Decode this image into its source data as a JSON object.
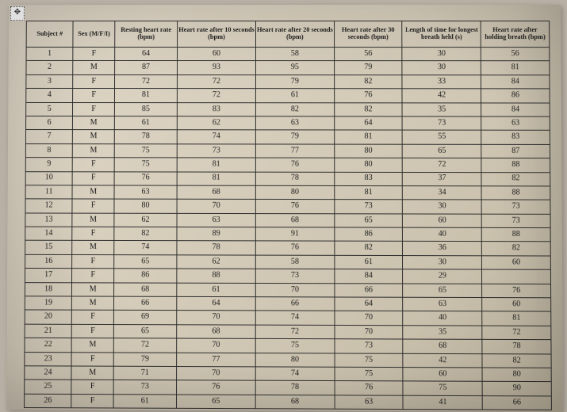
{
  "move_handle_glyph": "✥",
  "columns": [
    "Subject #",
    "Sex (M/F/I)",
    "Resting heart rate (bpm)",
    "Heart rate after 10 seconds (bpm)",
    "Heart rate after 20 seconds (bpm)",
    "Heart rate after 30 seconds (bpm)",
    "Length of time for longest breath held (s)",
    "Heart rate after holding breath (bpm)"
  ],
  "rows": [
    {
      "subject": "1",
      "sex": "F",
      "rest": "64",
      "hr10": "60",
      "hr20": "58",
      "hr30": "56",
      "time": "30",
      "hold": "56"
    },
    {
      "subject": "2",
      "sex": "M",
      "rest": "87",
      "hr10": "93",
      "hr20": "95",
      "hr30": "79",
      "time": "30",
      "hold": "81"
    },
    {
      "subject": "3",
      "sex": "F",
      "rest": "72",
      "hr10": "72",
      "hr20": "79",
      "hr30": "82",
      "time": "33",
      "hold": "84"
    },
    {
      "subject": "4",
      "sex": "F",
      "rest": "81",
      "hr10": "72",
      "hr20": "61",
      "hr30": "76",
      "time": "42",
      "hold": "86"
    },
    {
      "subject": "5",
      "sex": "F",
      "rest": "85",
      "hr10": "83",
      "hr20": "82",
      "hr30": "82",
      "time": "35",
      "hold": "84"
    },
    {
      "subject": "6",
      "sex": "M",
      "rest": "61",
      "hr10": "62",
      "hr20": "63",
      "hr30": "64",
      "time": "73",
      "hold": "63"
    },
    {
      "subject": "7",
      "sex": "M",
      "rest": "78",
      "hr10": "74",
      "hr20": "79",
      "hr30": "81",
      "time": "55",
      "hold": "83"
    },
    {
      "subject": "8",
      "sex": "M",
      "rest": "75",
      "hr10": "73",
      "hr20": "77",
      "hr30": "80",
      "time": "65",
      "hold": "87"
    },
    {
      "subject": "9",
      "sex": "F",
      "rest": "75",
      "hr10": "81",
      "hr20": "76",
      "hr30": "80",
      "time": "72",
      "hold": "88"
    },
    {
      "subject": "10",
      "sex": "F",
      "rest": "76",
      "hr10": "81",
      "hr20": "78",
      "hr30": "83",
      "time": "37",
      "hold": "82"
    },
    {
      "subject": "11",
      "sex": "M",
      "rest": "63",
      "hr10": "68",
      "hr20": "80",
      "hr30": "81",
      "time": "34",
      "hold": "88"
    },
    {
      "subject": "12",
      "sex": "F",
      "rest": "80",
      "hr10": "70",
      "hr20": "76",
      "hr30": "73",
      "time": "30",
      "hold": "73"
    },
    {
      "subject": "13",
      "sex": "M",
      "rest": "62",
      "hr10": "63",
      "hr20": "68",
      "hr30": "65",
      "time": "60",
      "hold": "73"
    },
    {
      "subject": "14",
      "sex": "F",
      "rest": "82",
      "hr10": "89",
      "hr20": "91",
      "hr30": "86",
      "time": "40",
      "hold": "88"
    },
    {
      "subject": "15",
      "sex": "M",
      "rest": "74",
      "hr10": "78",
      "hr20": "76",
      "hr30": "82",
      "time": "36",
      "hold": "82"
    },
    {
      "subject": "16",
      "sex": "F",
      "rest": "65",
      "hr10": "62",
      "hr20": "58",
      "hr30": "61",
      "time": "30",
      "hold": "60"
    },
    {
      "subject": "17",
      "sex": "F",
      "rest": "86",
      "hr10": "88",
      "hr20": "73",
      "hr30": "84",
      "time": "29",
      "hold": ""
    },
    {
      "subject": "18",
      "sex": "M",
      "rest": "68",
      "hr10": "61",
      "hr20": "70",
      "hr30": "66",
      "time": "65",
      "hold": "76"
    },
    {
      "subject": "19",
      "sex": "M",
      "rest": "66",
      "hr10": "64",
      "hr20": "66",
      "hr30": "64",
      "time": "63",
      "hold": "60"
    },
    {
      "subject": "20",
      "sex": "F",
      "rest": "69",
      "hr10": "70",
      "hr20": "74",
      "hr30": "70",
      "time": "40",
      "hold": "81"
    },
    {
      "subject": "21",
      "sex": "F",
      "rest": "65",
      "hr10": "68",
      "hr20": "72",
      "hr30": "70",
      "time": "35",
      "hold": "72"
    },
    {
      "subject": "22",
      "sex": "M",
      "rest": "72",
      "hr10": "70",
      "hr20": "75",
      "hr30": "73",
      "time": "68",
      "hold": "78"
    },
    {
      "subject": "23",
      "sex": "F",
      "rest": "79",
      "hr10": "77",
      "hr20": "80",
      "hr30": "75",
      "time": "42",
      "hold": "82"
    },
    {
      "subject": "24",
      "sex": "M",
      "rest": "71",
      "hr10": "70",
      "hr20": "74",
      "hr30": "75",
      "time": "60",
      "hold": "80"
    },
    {
      "subject": "25",
      "sex": "F",
      "rest": "73",
      "hr10": "76",
      "hr20": "78",
      "hr30": "76",
      "time": "75",
      "hold": "90"
    },
    {
      "subject": "26",
      "sex": "F",
      "rest": "61",
      "hr10": "65",
      "hr20": "68",
      "hr30": "63",
      "time": "41",
      "hold": "66"
    }
  ]
}
